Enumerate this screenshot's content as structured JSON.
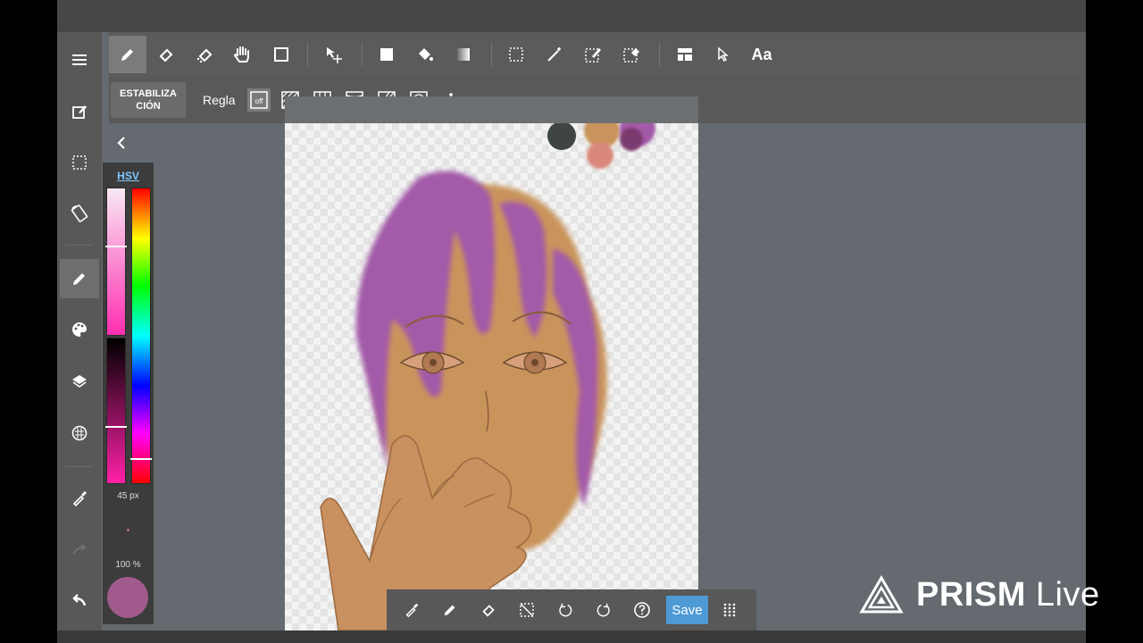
{
  "toolbar": {
    "tools": [
      "pencil-icon",
      "eraser-icon",
      "blur-eraser-icon",
      "hand-icon",
      "shape-icon",
      "move-icon",
      "fill-rect-icon",
      "bucket-icon",
      "gradient-icon",
      "select-rect-icon",
      "magic-wand-icon",
      "select-pen-icon",
      "select-eraser-icon",
      "panel-icon",
      "pointer-icon"
    ],
    "text_tool_label": "Aa"
  },
  "subbar": {
    "stabilizer_label": "ESTABILIZA CIÓN",
    "ruler_label": "Regla",
    "ruler_off_label": "off"
  },
  "color_panel": {
    "mode_label": "HSV",
    "brush_size": "45 px",
    "opacity": "100 %",
    "current_color": "#a05a8c"
  },
  "bottom_bar": {
    "save_label": "Save"
  },
  "watermark": {
    "brand_bold": "PRISM",
    "brand_light": "Live"
  },
  "colors": {
    "accent": "#4d9ad4",
    "hair": "#a35aa8",
    "skin": "#c9945c"
  }
}
